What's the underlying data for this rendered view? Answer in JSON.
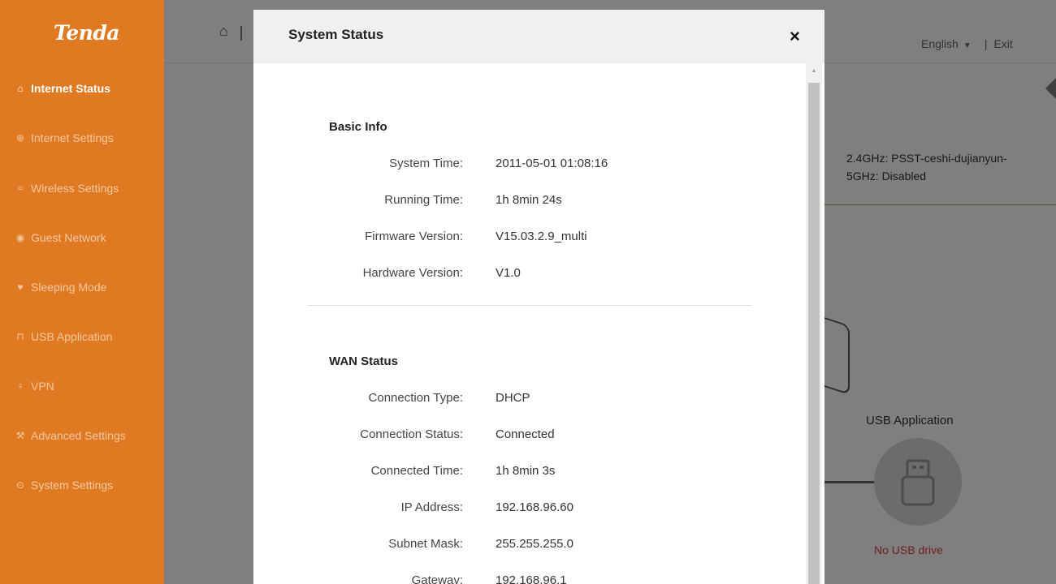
{
  "sidebar": {
    "logo": "Tenda",
    "items": [
      {
        "label": "Internet Status",
        "icon": "router-icon",
        "glyph": "⌂"
      },
      {
        "label": "Internet Settings",
        "icon": "globe-icon",
        "glyph": "⊕"
      },
      {
        "label": "Wireless Settings",
        "icon": "wifi-icon",
        "glyph": "≈"
      },
      {
        "label": "Guest Network",
        "icon": "guest-icon",
        "glyph": "◉"
      },
      {
        "label": "Sleeping Mode",
        "icon": "bulb-icon",
        "glyph": "♥"
      },
      {
        "label": "USB Application",
        "icon": "usb-icon",
        "glyph": "⊓"
      },
      {
        "label": "VPN",
        "icon": "vpn-icon",
        "glyph": "♀"
      },
      {
        "label": "Advanced Settings",
        "icon": "wrench-icon",
        "glyph": "⚒"
      },
      {
        "label": "System Settings",
        "icon": "settings-icon",
        "glyph": "⊙"
      }
    ]
  },
  "header": {
    "language": "English",
    "separator": "|",
    "exit": "Exit"
  },
  "background": {
    "wifi_24": "2.4GHz: PSST-ceshi-dujianyun-",
    "wifi_5": "5GHz: Disabled",
    "usb_title": "USB Application",
    "usb_status": "No USB drive"
  },
  "modal": {
    "title": "System Status",
    "close": "×",
    "basic": {
      "title": "Basic Info",
      "rows": [
        {
          "label": "System Time:",
          "value": "2011-05-01 01:08:16"
        },
        {
          "label": "Running Time:",
          "value": "1h 8min 24s"
        },
        {
          "label": "Firmware Version:",
          "value": "V15.03.2.9_multi"
        },
        {
          "label": "Hardware Version:",
          "value": "V1.0"
        }
      ]
    },
    "wan": {
      "title": "WAN Status",
      "rows": [
        {
          "label": "Connection Type:",
          "value": "DHCP"
        },
        {
          "label": "Connection Status:",
          "value": "Connected"
        },
        {
          "label": "Connected Time:",
          "value": "1h 8min 3s"
        },
        {
          "label": "IP Address:",
          "value": "192.168.96.60"
        },
        {
          "label": "Subnet Mask:",
          "value": "255.255.255.0"
        },
        {
          "label": "Gateway:",
          "value": "192.168.96.1"
        }
      ]
    }
  },
  "colors": {
    "sidebar_bg": "#e07a22",
    "accent_green": "#8ab53a",
    "error_red": "#e04040"
  }
}
